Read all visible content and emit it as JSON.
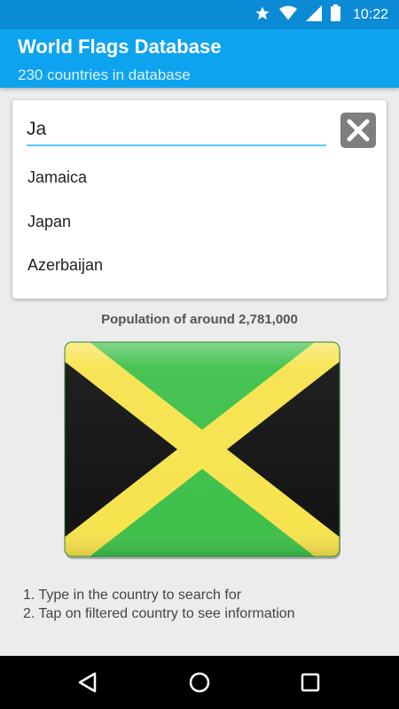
{
  "status_bar": {
    "time": "10:22",
    "icons": [
      "star-icon",
      "wifi-icon",
      "signal-icon",
      "battery-icon"
    ]
  },
  "app_bar": {
    "title": "World Flags Database",
    "subtitle": "230 countries in database",
    "color": "#0ea3ef"
  },
  "search": {
    "value": "Ja",
    "clear_icon": "close-icon",
    "suggestions": [
      "Jamaica",
      "Japan",
      "Azerbaijan"
    ]
  },
  "country": {
    "population_text": "Population of around 2,781,000",
    "flag_colors": {
      "green": "#3fc04b",
      "gold": "#f7e34e",
      "black": "#141414"
    }
  },
  "instructions": [
    "1. Type in the country to search for",
    "2. Tap on filtered country to see information"
  ],
  "nav": {
    "back_icon": "back-triangle-icon",
    "home_icon": "home-circle-icon",
    "recents_icon": "recents-square-icon"
  }
}
